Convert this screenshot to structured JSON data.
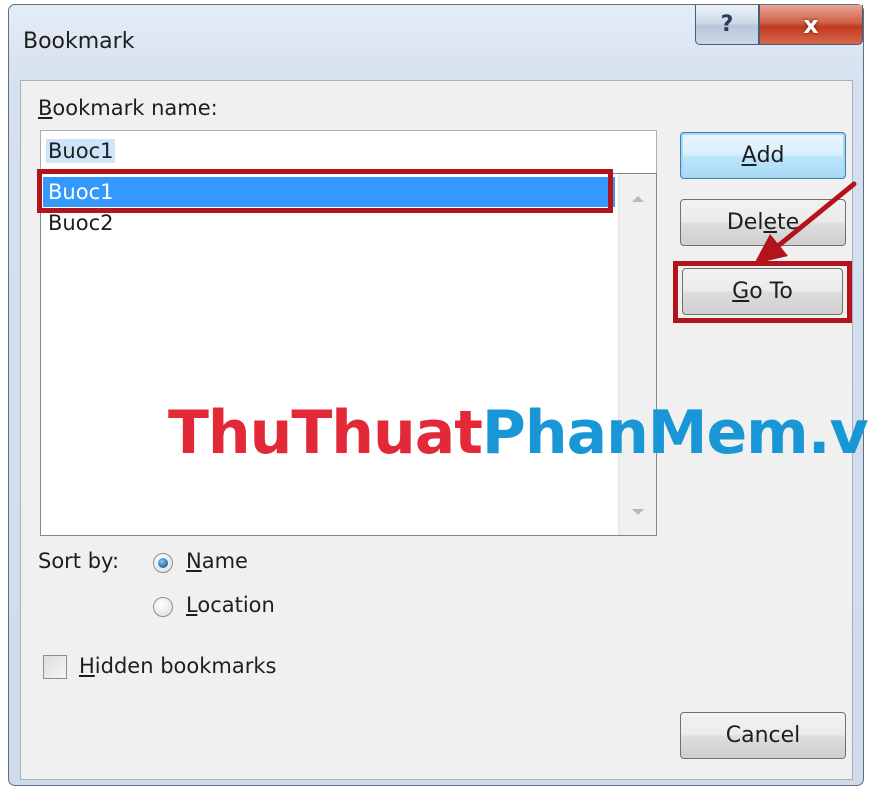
{
  "window": {
    "title": "Bookmark",
    "help_glyph": "?",
    "close_glyph": "x"
  },
  "bookmark_name": {
    "label_prefix": "",
    "label_underlined": "B",
    "label_rest": "ookmark name:",
    "value": "Buoc1"
  },
  "bookmark_list": {
    "items": [
      {
        "label": "Buoc1",
        "selected": true
      },
      {
        "label": "Buoc2",
        "selected": false
      }
    ]
  },
  "buttons": {
    "add": {
      "underlined": "A",
      "rest": "dd"
    },
    "delete": {
      "prefix": "Del",
      "underlined": "e",
      "rest": "te"
    },
    "goto": {
      "underlined": "G",
      "rest": "o To"
    },
    "cancel": {
      "label": "Cancel"
    }
  },
  "sort_by": {
    "label": "Sort by:",
    "options": [
      {
        "underlined": "N",
        "rest": "ame",
        "selected": true
      },
      {
        "underlined": "L",
        "rest": "ocation",
        "selected": false
      }
    ]
  },
  "hidden_bookmarks": {
    "underlined": "H",
    "rest": "idden bookmarks",
    "checked": false
  },
  "watermark": {
    "part1": "ThuThuat",
    "part2": "PhanMem.vn"
  },
  "colors": {
    "highlight_red": "#b3141c",
    "selection_blue": "#3399ff",
    "watermark_red": "#e32838",
    "watermark_blue": "#1996d6"
  }
}
